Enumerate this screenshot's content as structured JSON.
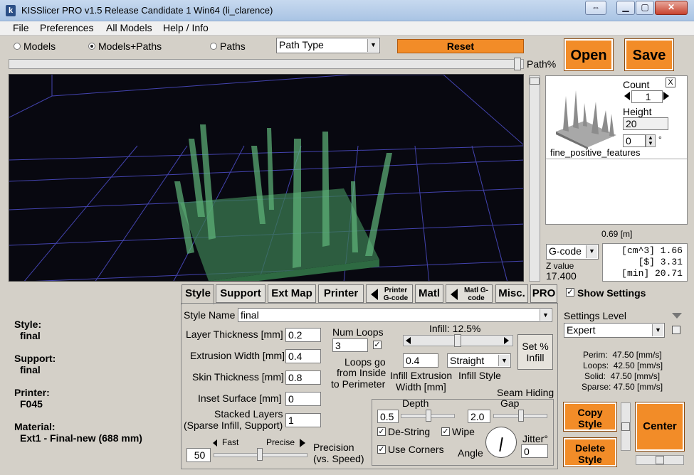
{
  "window": {
    "title": "KISSlicer PRO v1.5 Release Candidate 1 Win64 (li_clarence)",
    "app_icon": "k"
  },
  "menu": [
    "File",
    "Preferences",
    "All Models",
    "Help / Info"
  ],
  "view_modes": {
    "models": "Models",
    "models_paths": "Models+Paths",
    "paths": "Paths",
    "selected": "Models+Paths"
  },
  "path_type": "Path Type",
  "reset_label": "Reset",
  "path_pct_label": "Path%",
  "open_label": "Open",
  "save_label": "Save",
  "model": {
    "count_label": "Count",
    "count": "1",
    "height_label": "Height",
    "height": "20",
    "rotation": "0",
    "degree": "°",
    "name": "fine_positive_features",
    "close": "X",
    "size_readout": "0.69 [m]"
  },
  "output": {
    "format": "G-code",
    "z_label": "Z value",
    "z_value": "17.400",
    "stats": [
      "[cm^3] 1.66",
      "[$] 3.31",
      "[min] 20.71"
    ]
  },
  "tabs": [
    "Style",
    "Support",
    "Ext Map",
    "Printer",
    "Printer G-code",
    "Matl",
    "Matl G-code",
    "Misc.",
    "PRO"
  ],
  "active_tab": "Style",
  "summary": {
    "style_label": "Style:",
    "style": "final",
    "support_label": "Support:",
    "support": "final",
    "printer_label": "Printer:",
    "printer": "F045",
    "material_label": "Material:",
    "material": "Ext1 - Final-new (688 mm)"
  },
  "style_form": {
    "style_name_label": "Style Name",
    "style_name": "final",
    "layer_thickness_label": "Layer Thickness [mm]",
    "layer_thickness": "0.2",
    "extrusion_width_label": "Extrusion Width [mm]",
    "extrusion_width": "0.4",
    "skin_thickness_label": "Skin Thickness [mm]",
    "skin_thickness": "0.8",
    "inset_surface_label": "Inset  Surface [mm]",
    "inset_surface": "0",
    "stacked_layers_label1": "Stacked Layers",
    "stacked_layers_label2": "(Sparse Infill, Support)",
    "stacked_layers": "1",
    "num_loops_label": "Num Loops",
    "num_loops": "3",
    "loops_label1": "Loops go",
    "loops_label2": "from Inside",
    "loops_label3": "to Perimeter",
    "infill_label": "Infill: 12.5%",
    "infill_fraction": 0.5,
    "set_infill_label1": "Set %",
    "set_infill_label2": "Infill",
    "infill_width": "0.4",
    "infill_style": "Straight",
    "infill_width_label1": "Infill Extrusion",
    "infill_width_label2": "Width [mm]",
    "infill_style_label": "Infill Style",
    "seam_label": "Seam Hiding",
    "depth_label": "Depth",
    "depth": "0.5",
    "gap_label": "Gap",
    "gap": "2.0",
    "destring_label": "De-String",
    "wipe_label": "Wipe",
    "corners_label": "Use Corners",
    "angle_label": "Angle",
    "jitter_label": "Jitter°",
    "jitter": "0",
    "fast_label": "Fast",
    "precise_label": "Precise",
    "precision": "50",
    "precision_label1": "Precision",
    "precision_label2": "(vs. Speed)"
  },
  "settings": {
    "show_label": "Show Settings",
    "level_label": "Settings Level",
    "level": "Expert",
    "speeds": [
      "Perim:  47.50 [mm/s]",
      "Loops:  42.50 [mm/s]",
      "Solid:  47.50 [mm/s]",
      "Sparse: 47.50 [mm/s]"
    ],
    "copy_style1": "Copy",
    "copy_style2": "Style",
    "delete_style1": "Delete",
    "delete_style2": "Style",
    "center_label": "Center"
  },
  "colors": {
    "accent": "#f28c28",
    "grid": "#5050c8",
    "model": "#4fa86a"
  }
}
